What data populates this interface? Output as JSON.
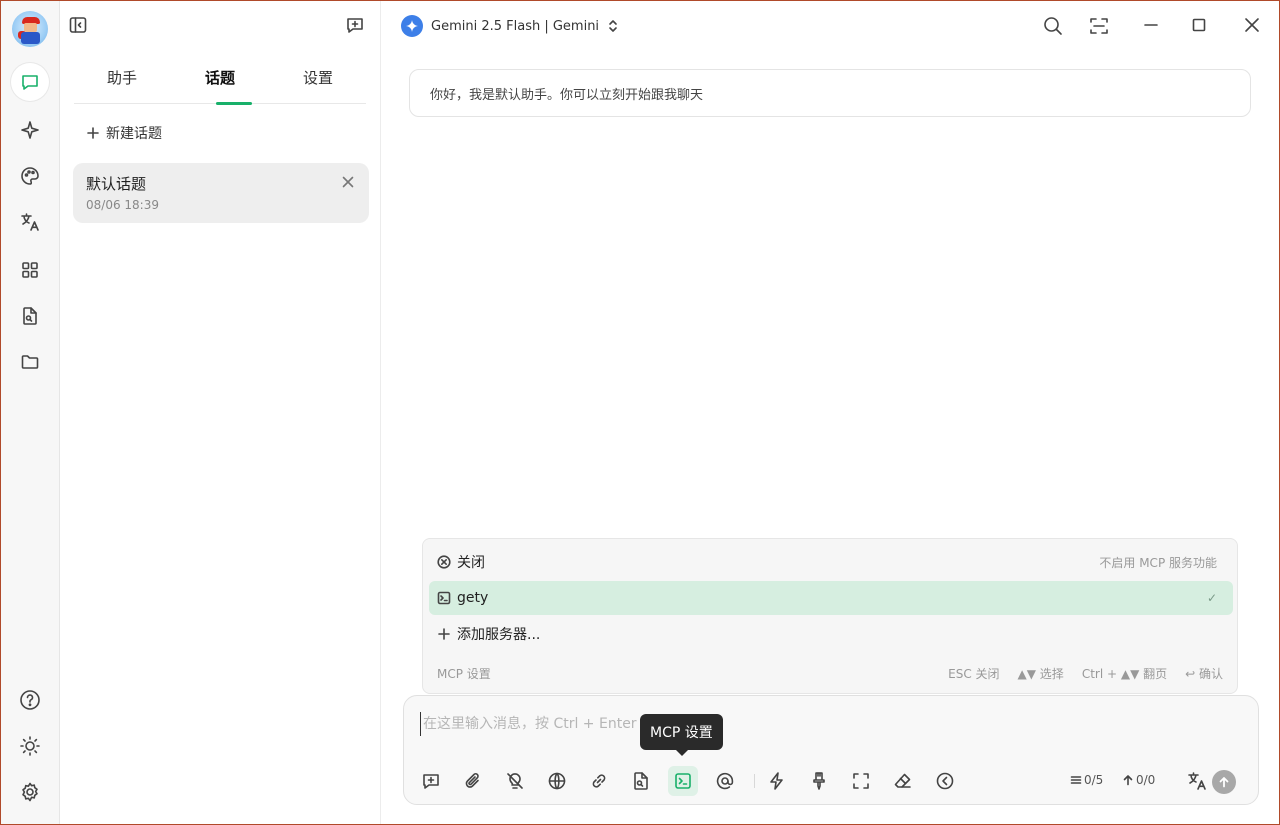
{
  "app": {
    "model_label": "Gemini 2.5 Flash | Gemini"
  },
  "sidebar": {
    "tabs": [
      "助手",
      "话题",
      "设置"
    ],
    "active_tab": "话题",
    "new_topic_label": "新建话题",
    "topics": [
      {
        "title": "默认话题",
        "time": "08/06 18:39"
      }
    ]
  },
  "chat": {
    "greeting": "你好，我是默认助手。你可以立刻开始跟我聊天"
  },
  "mcp_popup": {
    "rows": [
      {
        "label": "关闭",
        "hint": "不启用 MCP 服务功能"
      },
      {
        "label": "gety",
        "hint": "✓"
      },
      {
        "label": "添加服务器..."
      }
    ],
    "footer_title": "MCP 设置",
    "keys": [
      "ESC 关闭",
      "▲▼ 选择",
      "Ctrl + ▲▼ 翻页",
      "↩ 确认"
    ]
  },
  "composer": {
    "placeholder": "在这里输入消息，按 Ctrl + Enter 发送",
    "value": "",
    "msg_count": "0/5",
    "token_count": "0/0"
  },
  "tooltip": {
    "label": "MCP 设置"
  },
  "colors": {
    "accent": "#18b06a",
    "selected_row": "#d6eee0",
    "tooltip_bg": "#2a2a2a"
  }
}
